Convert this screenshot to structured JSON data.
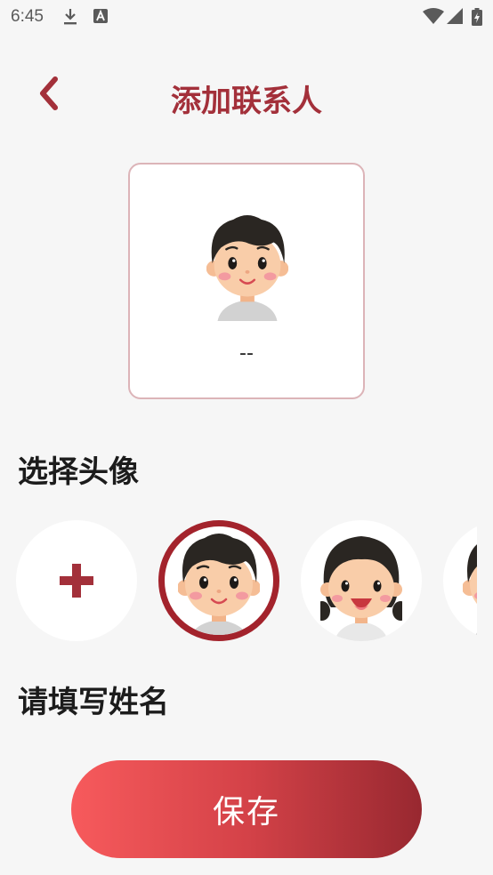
{
  "status_bar": {
    "time": "6:45",
    "icons": [
      "download-icon",
      "text-a-icon",
      "wifi-icon",
      "signal-icon",
      "battery-icon"
    ]
  },
  "header": {
    "title": "添加联系人",
    "back_icon": "chevron-left-icon"
  },
  "preview": {
    "avatar": "boy-avatar",
    "name": "--"
  },
  "avatar_section": {
    "title": "选择头像",
    "options": [
      {
        "type": "add",
        "icon": "plus-icon",
        "selected": false
      },
      {
        "type": "boy-avatar",
        "selected": true
      },
      {
        "type": "girl-avatar",
        "selected": false
      },
      {
        "type": "boy-avatar-partial",
        "selected": false
      }
    ]
  },
  "name_section": {
    "title": "请填写姓名"
  },
  "save": {
    "label": "保存"
  },
  "colors": {
    "accent": "#a3303a",
    "selected_ring": "#a3232c",
    "card_border": "#dcb4b8",
    "button_start": "#f75a5c",
    "button_end": "#982830",
    "background": "#f6f6f6"
  }
}
